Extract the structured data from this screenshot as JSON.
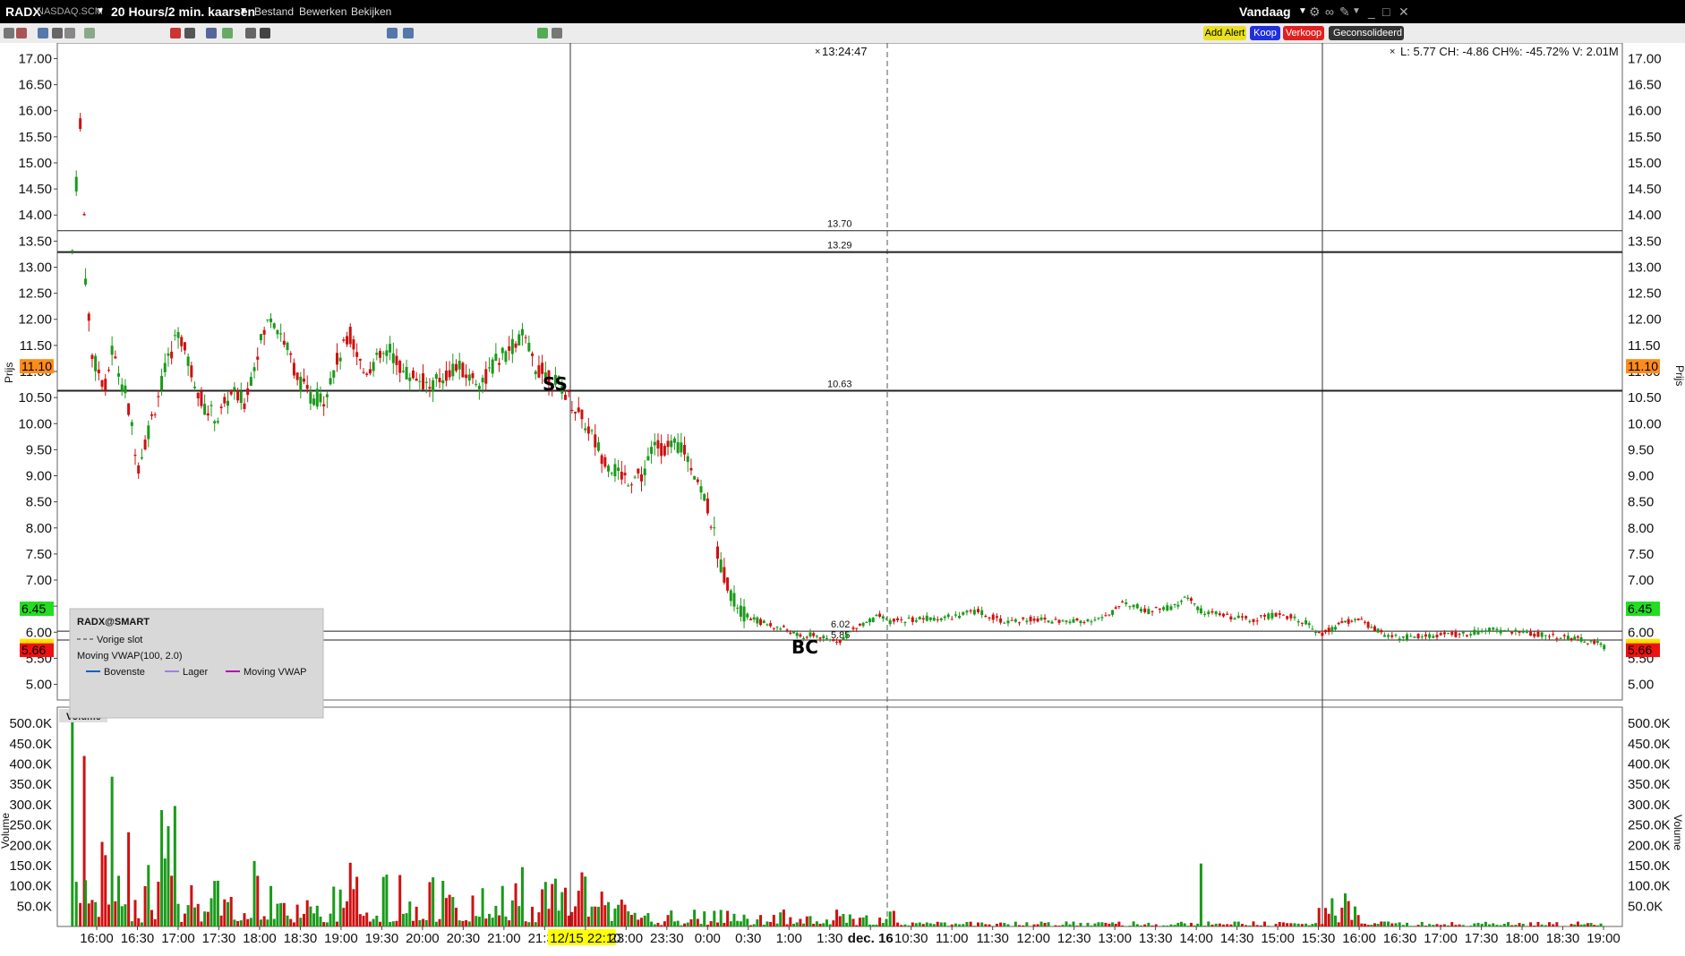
{
  "header": {
    "symbol": "RADX",
    "exchange": "NASDAQ.SCM",
    "period": "20 Hours/2 min. kaarsen",
    "menu": [
      "Bestand",
      "Bewerken",
      "Bekijken"
    ],
    "today": "Vandaag"
  },
  "toolbar": {
    "add_alert": "Add Alert",
    "buy": "Koop",
    "sell": "Verkoop",
    "consolidated": "Geconsolideerd",
    "icons": [
      "open-icon",
      "save-icon",
      "print-icon",
      "undo-icon",
      "settings-icon",
      "grid-icon",
      "pencil-icon",
      "bars-icon",
      "mountain-icon",
      "circle-icon",
      "crosshair-icon",
      "cursor-icon",
      "zoom-in-icon",
      "zoom-out-icon",
      "refresh-icon",
      "pin-icon"
    ]
  },
  "chart_data": {
    "type": "candlestick",
    "y_label": "Prijs",
    "volume_label": "Volume",
    "price_ticks": [
      "17.00",
      "16.50",
      "16.00",
      "15.50",
      "15.00",
      "14.50",
      "14.00",
      "13.50",
      "13.00",
      "12.50",
      "12.00",
      "11.50",
      "11.00",
      "10.50",
      "10.00",
      "9.50",
      "9.00",
      "8.50",
      "8.00",
      "7.50",
      "7.00",
      "6.50",
      "6.00",
      "5.50",
      "5.00"
    ],
    "volume_ticks": [
      "500.0K",
      "450.0K",
      "400.0K",
      "350.0K",
      "300.0K",
      "250.0K",
      "200.0K",
      "150.0K",
      "100.0K",
      "50.0K"
    ],
    "time_ticks": [
      "16:00",
      "16:30",
      "17:00",
      "17:30",
      "18:00",
      "18:30",
      "19:00",
      "19:30",
      "20:00",
      "20:30",
      "21:00",
      "21:30",
      "12/15 22:10",
      "23:00",
      "23:30",
      "0:00",
      "0:30",
      "1:00",
      "1:30",
      "dec. 16",
      "10:30",
      "11:00",
      "11:30",
      "12:00",
      "12:30",
      "13:00",
      "13:30",
      "14:00",
      "14:30",
      "15:00",
      "15:30",
      "16:00",
      "16:30",
      "17:00",
      "17:30",
      "18:00",
      "18:30",
      "19:00"
    ],
    "ylim": [
      4.7,
      17.3
    ],
    "volume_ylim": [
      0,
      540000
    ],
    "crosshair_time": "13:24:47",
    "info_line": "L: 5.77 CH: -4.86 CH%: -45.72% V: 2.01M",
    "last_price_label": "11.10",
    "green_price_label": "6.45",
    "red_price_label": "5.66",
    "yellow_price_label": "5.77",
    "horizontal_lines": [
      {
        "price": 13.7,
        "label": "13.70"
      },
      {
        "price": 13.29,
        "label": "13.29"
      },
      {
        "price": 10.63,
        "label": "10.63"
      },
      {
        "price": 6.02,
        "label": "6.02"
      },
      {
        "price": 5.85,
        "label": "5.85"
      }
    ],
    "annotations": [
      {
        "text": "SS",
        "time": "21:55",
        "price": 10.6
      },
      {
        "text": "BC",
        "time": "1:00",
        "price": 5.6
      }
    ],
    "price_path": [
      [
        "15:50",
        13.3
      ],
      [
        "15:53",
        14.6
      ],
      [
        "15:56",
        15.8
      ],
      [
        "15:59",
        14.0
      ],
      [
        "16:00",
        12.8
      ],
      [
        "16:05",
        11.3
      ],
      [
        "16:15",
        10.7
      ],
      [
        "16:20",
        11.4
      ],
      [
        "16:30",
        10.6
      ],
      [
        "16:40",
        9.2
      ],
      [
        "16:50",
        10.1
      ],
      [
        "17:00",
        11.0
      ],
      [
        "17:10",
        11.8
      ],
      [
        "17:20",
        11.0
      ],
      [
        "17:30",
        10.3
      ],
      [
        "17:40",
        10.1
      ],
      [
        "17:50",
        10.6
      ],
      [
        "18:00",
        10.4
      ],
      [
        "18:10",
        11.4
      ],
      [
        "18:20",
        12.1
      ],
      [
        "18:30",
        11.6
      ],
      [
        "18:40",
        10.9
      ],
      [
        "18:50",
        10.5
      ],
      [
        "19:00",
        10.5
      ],
      [
        "19:10",
        11.2
      ],
      [
        "19:20",
        11.7
      ],
      [
        "19:30",
        11.0
      ],
      [
        "19:40",
        11.2
      ],
      [
        "19:50",
        11.4
      ],
      [
        "20:00",
        11.0
      ],
      [
        "20:10",
        10.9
      ],
      [
        "20:20",
        10.7
      ],
      [
        "20:30",
        10.9
      ],
      [
        "20:40",
        11.1
      ],
      [
        "20:50",
        10.9
      ],
      [
        "21:00",
        10.8
      ],
      [
        "21:10",
        11.2
      ],
      [
        "21:20",
        11.4
      ],
      [
        "21:30",
        11.7
      ],
      [
        "21:40",
        11.1
      ],
      [
        "21:50",
        10.9
      ],
      [
        "22:00",
        10.7
      ],
      [
        "22:10",
        10.3
      ],
      [
        "22:20",
        9.9
      ],
      [
        "22:30",
        9.4
      ],
      [
        "22:40",
        9.1
      ],
      [
        "22:50",
        8.95
      ],
      [
        "23:00",
        9.0
      ],
      [
        "23:10",
        9.6
      ],
      [
        "23:20",
        9.5
      ],
      [
        "23:30",
        9.6
      ],
      [
        "23:40",
        9.1
      ],
      [
        "23:50",
        8.4
      ],
      [
        "0:00",
        7.3
      ],
      [
        "0:10",
        6.6
      ],
      [
        "0:20",
        6.3
      ],
      [
        "0:30",
        6.2
      ],
      [
        "0:40",
        6.1
      ],
      [
        "0:50",
        6.05
      ],
      [
        "1:00",
        5.9
      ],
      [
        "1:10",
        5.95
      ],
      [
        "1:20",
        5.85
      ],
      [
        "1:30",
        5.85
      ],
      [
        "1:40",
        6.05
      ],
      [
        "1:50",
        6.2
      ],
      [
        "2:00",
        6.3
      ],
      [
        "10:10",
        6.2
      ],
      [
        "10:30",
        6.25
      ],
      [
        "11:00",
        6.3
      ],
      [
        "11:20",
        6.4
      ],
      [
        "11:40",
        6.2
      ],
      [
        "12:00",
        6.25
      ],
      [
        "12:30",
        6.2
      ],
      [
        "13:00",
        6.3
      ],
      [
        "13:10",
        6.6
      ],
      [
        "13:30",
        6.4
      ],
      [
        "13:50",
        6.5
      ],
      [
        "14:00",
        6.7
      ],
      [
        "14:10",
        6.4
      ],
      [
        "14:30",
        6.3
      ],
      [
        "14:50",
        6.25
      ],
      [
        "15:10",
        6.35
      ],
      [
        "15:30",
        6.2
      ],
      [
        "15:40",
        5.95
      ],
      [
        "15:50",
        6.05
      ],
      [
        "16:00",
        6.2
      ],
      [
        "16:10",
        6.25
      ],
      [
        "16:20",
        6.1
      ],
      [
        "16:30",
        5.95
      ],
      [
        "16:50",
        5.9
      ],
      [
        "17:10",
        5.95
      ],
      [
        "17:30",
        5.95
      ],
      [
        "17:50",
        6.05
      ],
      [
        "18:10",
        6.0
      ],
      [
        "18:30",
        5.95
      ],
      [
        "18:50",
        5.9
      ],
      [
        "19:00",
        5.85
      ],
      [
        "19:10",
        5.8
      ],
      [
        "19:20",
        5.7
      ]
    ]
  },
  "legend": {
    "title": "RADX@SMART",
    "prev_close": "Vorige slot",
    "indicator": "Moving VWAP(100, 2.0)",
    "items": [
      "Bovenste",
      "Lager",
      "Moving VWAP"
    ]
  }
}
